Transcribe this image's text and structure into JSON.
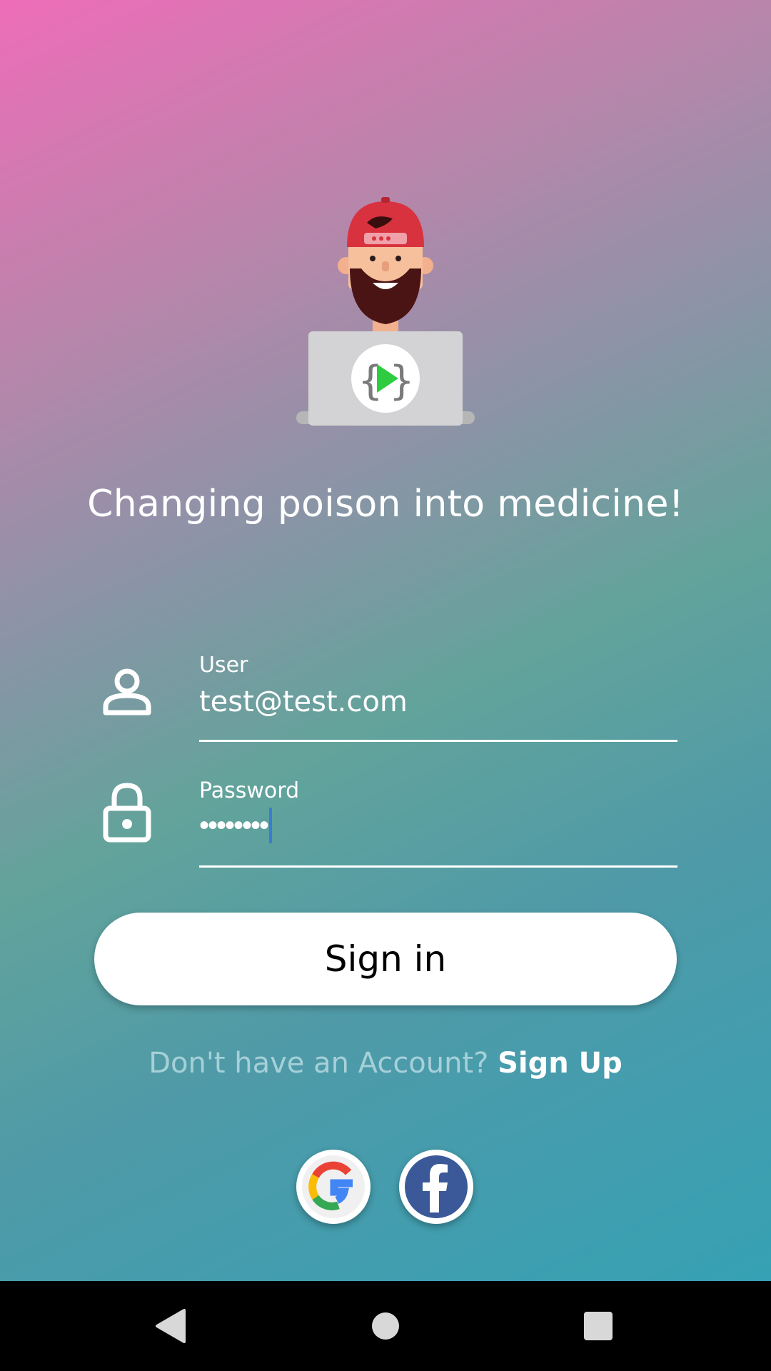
{
  "tagline": "Changing poison into medicine!",
  "user_field": {
    "label": "User",
    "value": "test@test.com",
    "icon": "person-outline-icon"
  },
  "password_field": {
    "label": "Password",
    "masked_value": "••••••••",
    "icon": "lock-icon"
  },
  "signin_label": "Sign in",
  "signup": {
    "question": "Don't have an Account?",
    "link": "Sign Up"
  },
  "social": [
    {
      "name": "google",
      "icon": "google-icon"
    },
    {
      "name": "facebook",
      "icon": "facebook-icon"
    }
  ],
  "navbar": [
    "back-icon",
    "home-icon",
    "recents-icon"
  ],
  "colors": {
    "gradient_top": "#ee6db8",
    "gradient_mid": "#62a39b",
    "gradient_bottom": "#36a1b4",
    "facebook_blue": "#3b5998",
    "avatar_cap": "#d9323f"
  }
}
